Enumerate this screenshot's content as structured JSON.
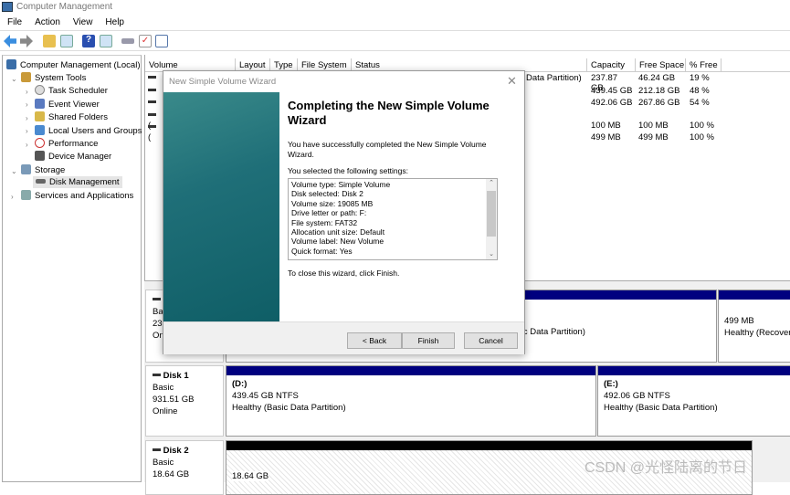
{
  "window": {
    "title": "Computer Management"
  },
  "menu": [
    "File",
    "Action",
    "View",
    "Help"
  ],
  "toolbar": {
    "icons": [
      "back-arrow-icon",
      "forward-arrow-icon",
      "up-folder-icon",
      "show-hide-tree-icon",
      "help-icon",
      "action-pane-icon",
      "connect-icon",
      "checklist-icon",
      "properties-icon"
    ]
  },
  "tree": {
    "root": "Computer Management (Local)",
    "system_tools": "System Tools",
    "items": [
      "Task Scheduler",
      "Event Viewer",
      "Shared Folders",
      "Local Users and Groups",
      "Performance",
      "Device Manager"
    ],
    "storage": "Storage",
    "disk_management": "Disk Management",
    "services": "Services and Applications"
  },
  "volumes": {
    "columns": [
      "Volume",
      "Layout",
      "Type",
      "File System",
      "Status",
      "Capacity",
      "Free Space",
      "% Free"
    ],
    "rows": [
      {
        "volume": "",
        "status": "Data Partition)",
        "capacity": "237.87 GB",
        "free": "46.24 GB",
        "pct": "19 %"
      },
      {
        "volume": "",
        "status": "",
        "capacity": "439.45 GB",
        "free": "212.18 GB",
        "pct": "48 %"
      },
      {
        "volume": "",
        "status": "",
        "capacity": "492.06 GB",
        "free": "267.86 GB",
        "pct": "54 %"
      },
      {
        "volume": "(",
        "status": "",
        "capacity": "100 MB",
        "free": "100 MB",
        "pct": "100 %"
      },
      {
        "volume": "(",
        "status": "",
        "capacity": "499 MB",
        "free": "499 MB",
        "pct": "100 %"
      }
    ]
  },
  "disks": [
    {
      "name": "",
      "type": "Basi",
      "size": "23",
      "state": "On",
      "partitions": [
        {
          "label": "",
          "size": "",
          "status": "sic Data Partition)"
        },
        {
          "label": "",
          "size": "499 MB",
          "status": "Healthy (Recover"
        }
      ]
    },
    {
      "name": "Disk 1",
      "type": "Basic",
      "size": "931.51 GB",
      "state": "Online",
      "partitions": [
        {
          "label": "(D:)",
          "size": "439.45 GB NTFS",
          "status": "Healthy (Basic Data Partition)"
        },
        {
          "label": "(E:)",
          "size": "492.06 GB NTFS",
          "status": "Healthy (Basic Data Partition)"
        }
      ]
    },
    {
      "name": "Disk 2",
      "type": "Basic",
      "size": "18.64 GB",
      "partitions": [
        {
          "size": "18.64 GB"
        }
      ]
    }
  ],
  "wizard": {
    "title": "New Simple Volume Wizard",
    "heading": "Completing the New Simple Volume Wizard",
    "success": "You have successfully completed the New Simple Volume Wizard.",
    "selected_label": "You selected the following settings:",
    "settings": [
      "Volume type: Simple Volume",
      "Disk selected: Disk 2",
      "Volume size: 19085 MB",
      "Drive letter or path: F:",
      "File system: FAT32",
      "Allocation unit size: Default",
      "Volume label: New Volume",
      "Quick format: Yes"
    ],
    "close_hint": "To close this wizard, click Finish.",
    "back": "< Back",
    "finish": "Finish",
    "cancel": "Cancel"
  },
  "watermark": "CSDN @光怪陆离的节日",
  "colors": {
    "partition_header": "#00007f",
    "unallocated_header": "#000000"
  }
}
